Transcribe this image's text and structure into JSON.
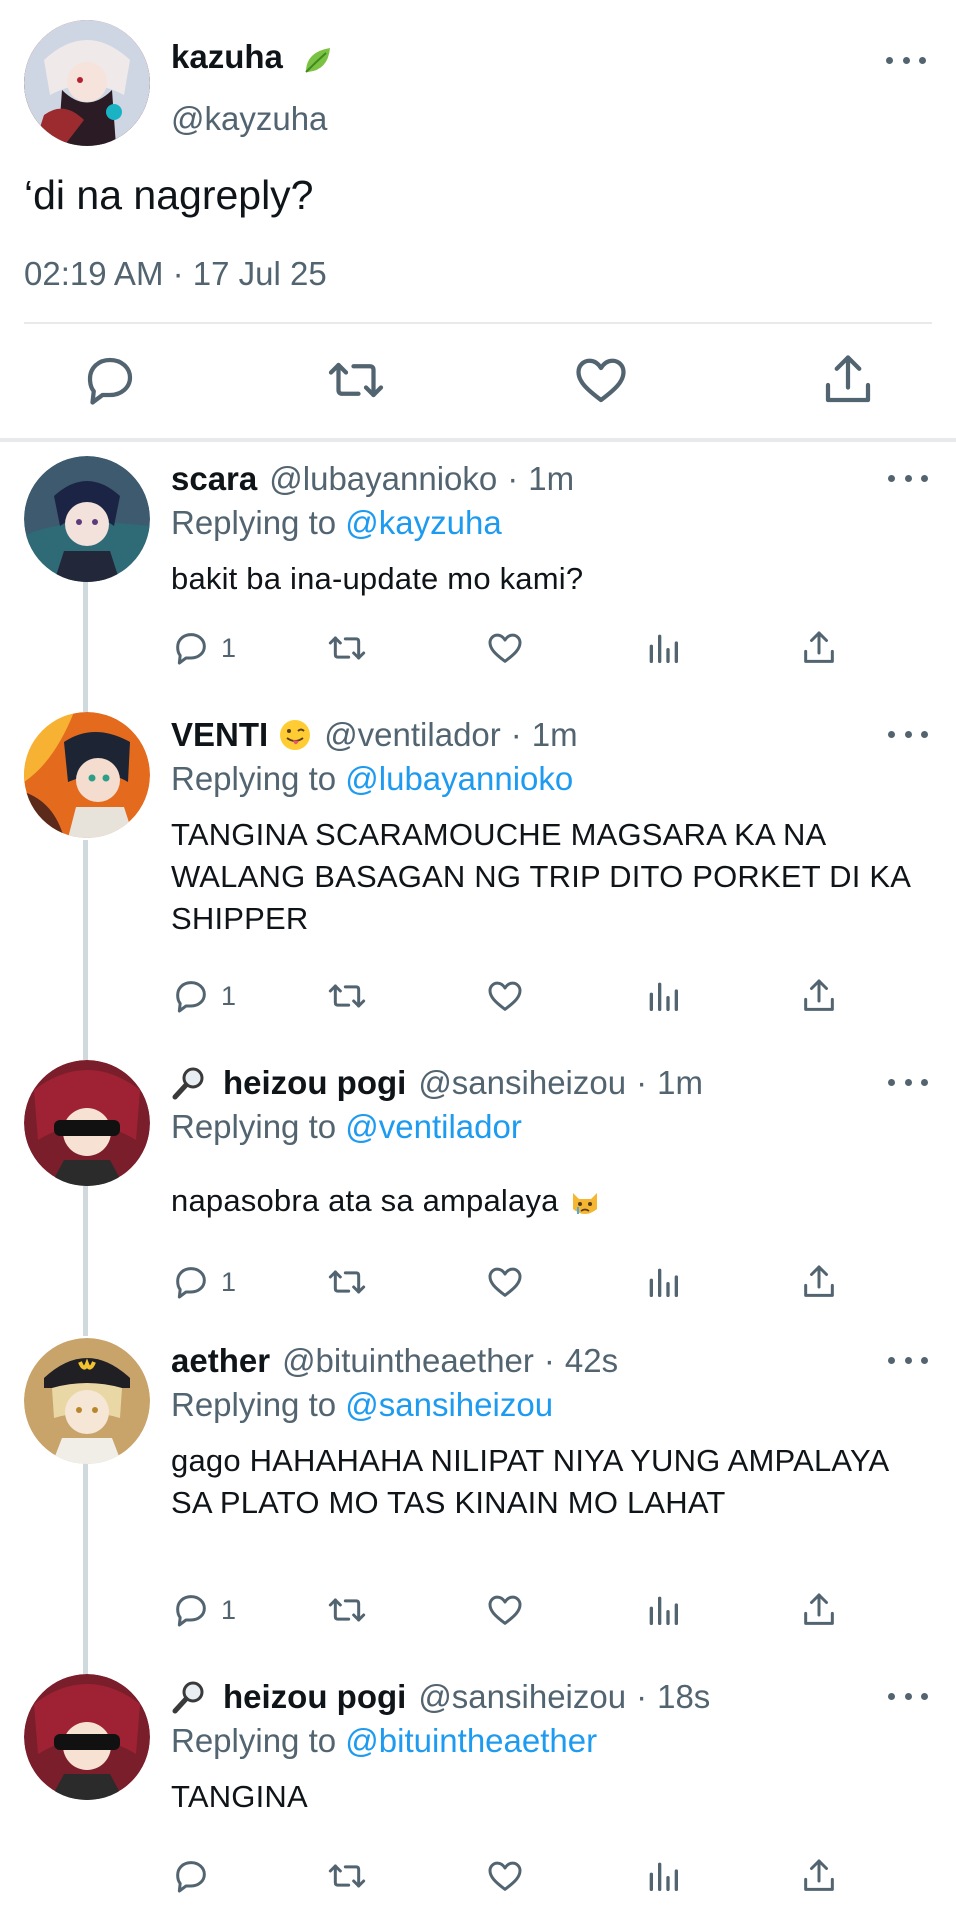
{
  "main_tweet": {
    "name": "kazuha",
    "handle": "@kayzuha",
    "text": "‘di na nagreply?",
    "timestamp": "02:19 AM · 17 Jul 25",
    "actions": [
      "reply-icon",
      "retweet-icon",
      "like-icon",
      "share-icon"
    ]
  },
  "replies": [
    {
      "name": "scara",
      "handle": "@lubayannioko",
      "time": "1m",
      "replying_prefix": "Replying to ",
      "replying_to": "@kayzuha",
      "text": "bakit ba ina-update mo kami?",
      "reply_count": "1"
    },
    {
      "name": "VENTI",
      "handle": "@ventilador",
      "time": "1m",
      "replying_prefix": "Replying to ",
      "replying_to": "@lubayannioko",
      "text": "TANGINA SCARAMOUCHE MAGSARA KA NA WALANG BASAGAN NG TRIP DITO PORKET DI KA SHIPPER",
      "reply_count": "1"
    },
    {
      "name": "heizou pogi",
      "handle": "@sansiheizou",
      "time": "1m",
      "replying_prefix": "Replying to ",
      "replying_to": "@ventilador",
      "text": "napasobra ata sa ampalaya",
      "reply_count": "1"
    },
    {
      "name": "aether",
      "handle": "@bituintheaether",
      "time": "42s",
      "replying_prefix": "Replying to ",
      "replying_to": "@sansiheizou",
      "text": "gago HAHAHAHA NILIPAT NIYA YUNG AMPALAYA SA PLATO MO TAS KINAIN MO LAHAT",
      "reply_count": "1"
    },
    {
      "name": "heizou pogi",
      "handle": "@sansiheizou",
      "time": "18s",
      "replying_prefix": "Replying to ",
      "replying_to": "@bituintheaether",
      "text": "TANGINA",
      "reply_count": ""
    }
  ],
  "colors": {
    "text": "#0f1419",
    "secondary": "#536471",
    "accent": "#1d9bf0",
    "divider": "#e7e9ea",
    "thread_line": "#cfd9de"
  }
}
